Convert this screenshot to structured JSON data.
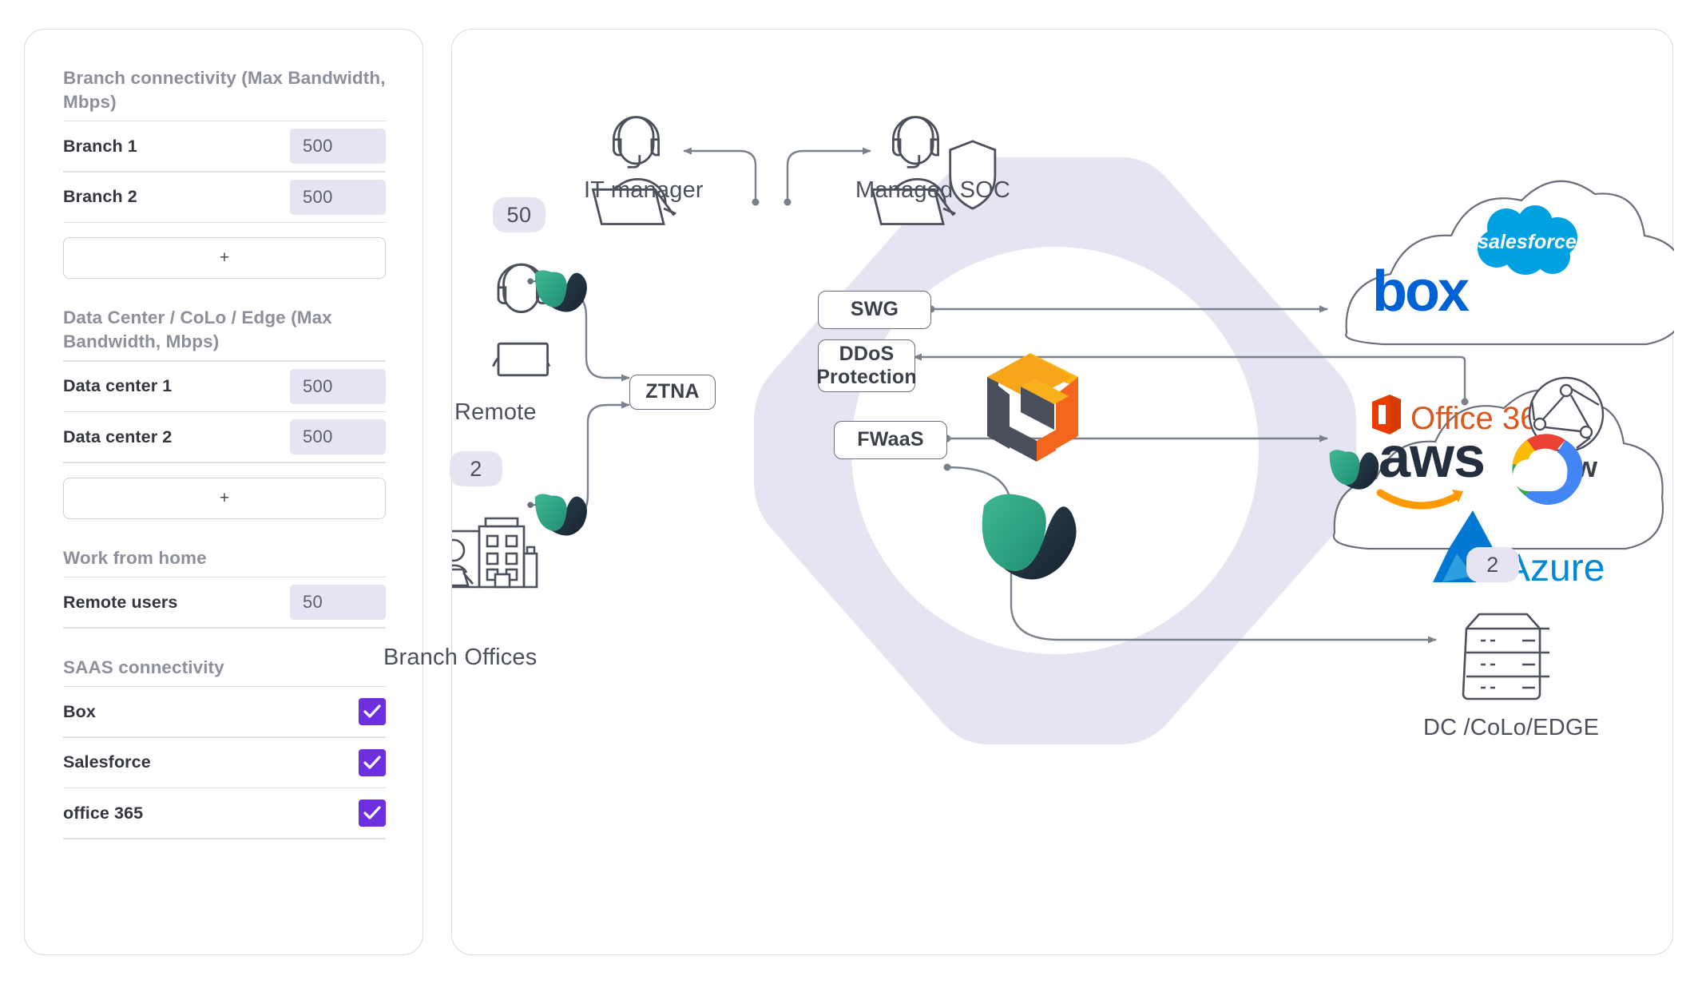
{
  "sidebar": {
    "groups": [
      {
        "title": "Branch connectivity (Max Bandwidth, Mbps)",
        "rows": [
          {
            "label": "Branch 1",
            "value": "500"
          },
          {
            "label": "Branch 2",
            "value": "500"
          }
        ],
        "add_label": "+"
      },
      {
        "title": "Data Center / CoLo / Edge (Max Bandwidth, Mbps)",
        "rows": [
          {
            "label": "Data center 1",
            "value": "500"
          },
          {
            "label": "Data center 2",
            "value": "500"
          }
        ],
        "add_label": "+"
      },
      {
        "title": "Work from home",
        "rows": [
          {
            "label": "Remote users",
            "value": "50"
          }
        ]
      },
      {
        "title": "SAAS connectivity",
        "checks": [
          {
            "label": "Box",
            "checked": true
          },
          {
            "label": "Salesforce",
            "checked": true
          },
          {
            "label": "office 365",
            "checked": true
          }
        ]
      }
    ]
  },
  "diagram": {
    "nodes": {
      "it_manager": "IT manager",
      "managed_soc": "Managed SOC",
      "remote": "Remote",
      "remote_badge": "50",
      "branch_offices": "Branch Offices",
      "branch_badge": "2",
      "dc_edge": "DC /CoLo/EDGE",
      "dc_badge": "2"
    },
    "services": [
      {
        "id": "ztna",
        "label": "ZTNA"
      },
      {
        "id": "swg",
        "label": "SWG"
      },
      {
        "id": "ddos",
        "label": "DDoS Protection"
      },
      {
        "id": "fwaas",
        "label": "FWaaS"
      }
    ],
    "saas_cloud": {
      "box": "box",
      "salesforce": "salesforce",
      "office365": "Office 365",
      "www": "www"
    },
    "iaas_cloud": {
      "aws": "aws",
      "azure": "Azure",
      "gcp": "google-cloud"
    },
    "colors": {
      "hex_fill": "#e6e4f2",
      "accent_purple": "#6d2fe0",
      "line": "#6b6f7c",
      "teal": "#2fa37f",
      "navy": "#23374a",
      "orange": "#f7941d",
      "deep_orange": "#f4661b",
      "slate": "#4a4f5c",
      "box_blue": "#0061d5",
      "salesforce_blue": "#00a1e0",
      "o365_orange": "#d83b01",
      "azure_blue": "#0089d6",
      "aws_dark": "#232f3e",
      "aws_orange": "#ff9900"
    }
  }
}
